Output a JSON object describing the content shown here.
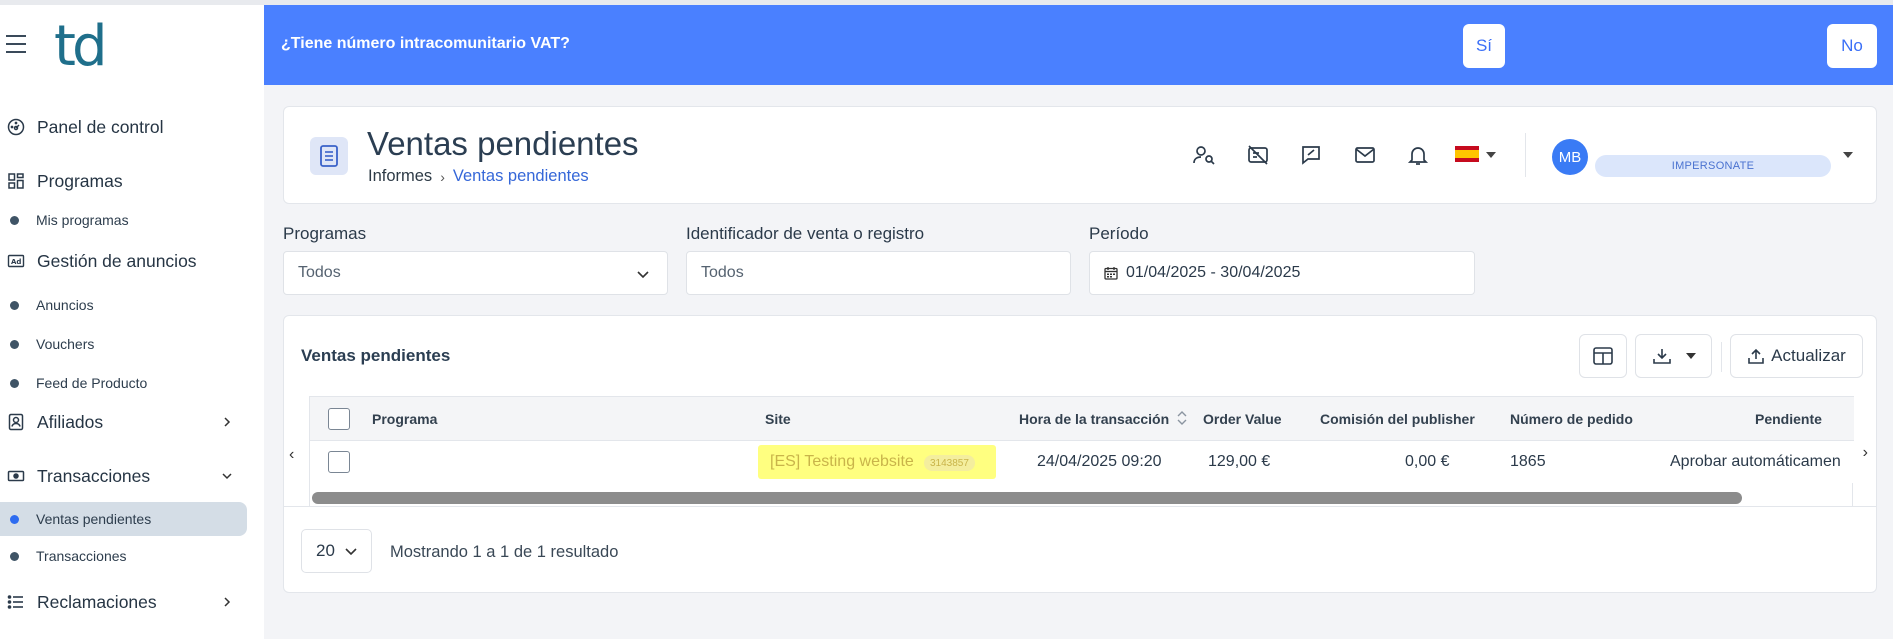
{
  "sidebar": {
    "logo": "td",
    "items": [
      {
        "type": "main",
        "label": "Panel de control",
        "icon": "dashboard-icon"
      },
      {
        "type": "main",
        "label": "Programas",
        "icon": "grid-icon"
      },
      {
        "type": "sub",
        "label": "Mis programas"
      },
      {
        "type": "main",
        "label": "Gestión de anuncios",
        "icon": "ad-icon"
      },
      {
        "type": "sub",
        "label": "Anuncios"
      },
      {
        "type": "sub",
        "label": "Vouchers"
      },
      {
        "type": "sub",
        "label": "Feed de Producto"
      },
      {
        "type": "main",
        "label": "Afiliados",
        "icon": "user-card-icon",
        "chevron": "right"
      },
      {
        "type": "main",
        "label": "Transacciones",
        "icon": "money-icon",
        "chevron": "down"
      },
      {
        "type": "sub",
        "label": "Ventas pendientes",
        "active": true
      },
      {
        "type": "sub",
        "label": "Transacciones"
      },
      {
        "type": "main",
        "label": "Reclamaciones",
        "icon": "list-icon",
        "chevron": "right"
      }
    ]
  },
  "banner": {
    "text": "¿Tiene número intracomunitario VAT?",
    "yes": "Sí",
    "no": "No"
  },
  "header": {
    "title": "Ventas pendientes",
    "breadcrumb_parent": "Informes",
    "breadcrumb_current": "Ventas pendientes",
    "avatar": "MB",
    "impersonate": "IMPERSONATE"
  },
  "filters": {
    "programs_label": "Programas",
    "programs_value": "Todos",
    "id_label": "Identificador de venta o registro",
    "id_placeholder": "Todos",
    "period_label": "Período",
    "period_value": "01/04/2025 - 30/04/2025"
  },
  "table": {
    "title": "Ventas pendientes",
    "refresh": "Actualizar",
    "columns": [
      "Programa",
      "Site",
      "Hora de la transacción",
      "Order Value",
      "Comisión del publisher",
      "Número de pedido",
      "Pendiente"
    ],
    "row": {
      "program": "",
      "site": "[ES] Testing website",
      "site_id": "3143857",
      "time": "24/04/2025 09:20",
      "order_value": "129,00 €",
      "commission": "0,00 €",
      "order_number": "1865",
      "pending": "Aprobar automáticamen"
    },
    "page_size": "20",
    "showing": "Mostrando 1 a 1 de 1 resultado"
  },
  "colors": {
    "banner": "#4a80ff",
    "accent": "#3567d8",
    "highlight": "#ffff80"
  }
}
